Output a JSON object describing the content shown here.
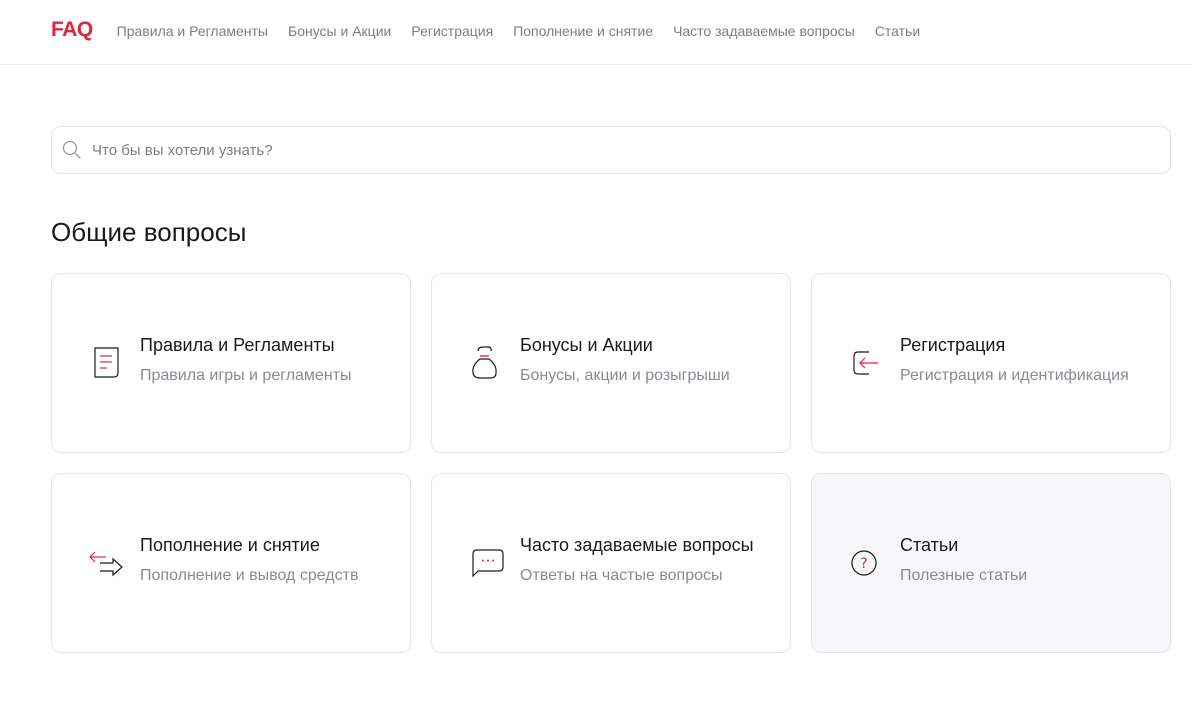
{
  "header": {
    "logo": "FAQ",
    "nav": [
      "Правила и Регламенты",
      "Бонусы и Акции",
      "Регистрация",
      "Пополнение и снятие",
      "Часто задаваемые вопросы",
      "Статьи"
    ]
  },
  "search": {
    "placeholder": "Что бы вы хотели узнать?",
    "icon": "search-icon"
  },
  "section": {
    "title": "Общие вопросы"
  },
  "cards": [
    {
      "title": "Правила и Регламенты",
      "desc": "Правила игры и регламенты",
      "icon": "document-icon"
    },
    {
      "title": "Бонусы и Акции",
      "desc": "Бонусы, акции и розыгрыши",
      "icon": "bag-icon"
    },
    {
      "title": "Регистрация",
      "desc": "Регистрация и идентификация",
      "icon": "login-icon"
    },
    {
      "title": "Пополнение и снятие",
      "desc": "Пополнение и вывод средств",
      "icon": "transfer-arrows-icon"
    },
    {
      "title": "Часто задаваемые вопросы",
      "desc": "Ответы на частые вопросы",
      "icon": "chat-bubble-icon"
    },
    {
      "title": "Статьи",
      "desc": "Полезные статьи",
      "icon": "question-circle-icon"
    }
  ],
  "colors": {
    "accent": "#e0243d",
    "text": "#1a1a1a",
    "muted": "#7d7d85",
    "border": "#e6e6ea",
    "active_card_bg": "#f7f7fa"
  }
}
